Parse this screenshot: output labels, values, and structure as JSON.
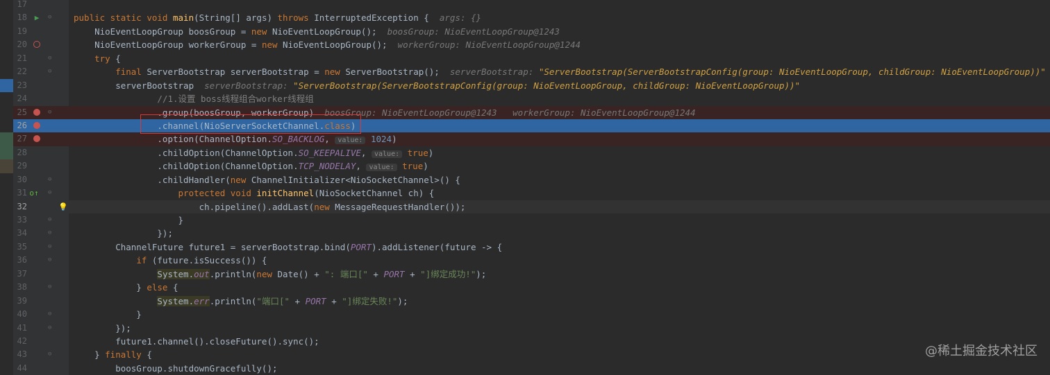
{
  "colors": {
    "editor_bg": "#2b2b2b",
    "gutter_bg": "#313335",
    "selection": "#2f65a0",
    "breakpoint_line": "#3a2323",
    "keyword": "#cc7832",
    "function": "#ffc66d",
    "string": "#6a8759",
    "number": "#6897bb",
    "constant": "#9876aa",
    "comment": "#808080"
  },
  "watermark": "@稀土掘金技术社区",
  "lines": [
    {
      "num": "17",
      "gutter": "none",
      "html": ""
    },
    {
      "num": "18",
      "gutter": "run",
      "html": "<span class='kw'>public static void </span><span class='fn'>main</span>(String[] args) <span class='kw'>throws </span>InterruptedException {  <span class='hint'>args: {}</span>"
    },
    {
      "num": "19",
      "gutter": "none",
      "html": "    NioEventLoopGroup boosGroup = <span class='kw'>new </span>NioEventLoopGroup();  <span class='hint'>boosGroup: NioEventLoopGroup@1243</span>"
    },
    {
      "num": "20",
      "gutter": "bp-hollow",
      "html": "    NioEventLoopGroup workerGroup = <span class='kw'>new </span>NioEventLoopGroup();  <span class='hint'>workerGroup: NioEventLoopGroup@1244</span>"
    },
    {
      "num": "21",
      "gutter": "none",
      "html": "    <span class='kw'>try </span>{"
    },
    {
      "num": "22",
      "gutter": "none",
      "html": "        <span class='kw'>final </span>ServerBootstrap serverBootstrap = <span class='kw'>new </span>ServerBootstrap();  <span class='hint'>serverBootstrap: </span><span class='hstr'>\"ServerBootstrap(ServerBootstrapConfig(group: NioEventLoopGroup, childGroup: NioEventLoopGroup))\"</span>"
    },
    {
      "num": "23",
      "gutter": "none",
      "html": "        serverBootstrap  <span class='hint'>serverBootstrap: </span><span class='hstr'>\"ServerBootstrap(ServerBootstrapConfig(group: NioEventLoopGroup, childGroup: NioEventLoopGroup))\"</span>"
    },
    {
      "num": "24",
      "gutter": "none",
      "html": "                <span class='cmt'>//1.设置 boss线程组合worker线程组</span>"
    },
    {
      "num": "25",
      "gutter": "bp",
      "html": "                .group(boosGroup, workerGroup)  <span class='hint'>boosGroup: NioEventLoopGroup@1243   workerGroup: NioEventLoopGroup@1244</span>"
    },
    {
      "num": "26",
      "gutter": "bp",
      "html": "                .channel(NioServerSocketChannel.<span class='kw'>class</span>)"
    },
    {
      "num": "27",
      "gutter": "bp",
      "html": "                .option(ChannelOption.<span class='const'>SO_BACKLOG</span>, <span class='pill'>value:</span> <span class='num'>1024</span>)"
    },
    {
      "num": "28",
      "gutter": "none",
      "html": "                .childOption(ChannelOption.<span class='const'>SO_KEEPALIVE</span>, <span class='pill'>value:</span> <span class='kw'>true</span>)"
    },
    {
      "num": "29",
      "gutter": "none",
      "html": "                .childOption(ChannelOption.<span class='const'>TCP_NODELAY</span>, <span class='pill'>value:</span> <span class='kw'>true</span>)"
    },
    {
      "num": "30",
      "gutter": "none",
      "html": "                .childHandler(<span class='kw'>new </span>ChannelInitializer&lt;NioSocketChannel&gt;() {"
    },
    {
      "num": "31",
      "gutter": "override",
      "html": "                    <span class='kw'>protected void </span><span class='fn'>initChannel</span>(NioSocketChannel ch) {"
    },
    {
      "num": "32",
      "gutter": "bulb",
      "html": "                        ch.pipeline().addLast(<span class='kw'>new </span>MessageRequestHandler());"
    },
    {
      "num": "33",
      "gutter": "none",
      "html": "                    }"
    },
    {
      "num": "34",
      "gutter": "none",
      "html": "                });"
    },
    {
      "num": "35",
      "gutter": "none",
      "html": "        ChannelFuture future1 = serverBootstrap.bind(<span class='const'>PORT</span>).addListener(future -&gt; {"
    },
    {
      "num": "36",
      "gutter": "none",
      "html": "            <span class='kw'>if </span>(future.isSuccess()) {"
    },
    {
      "num": "37",
      "gutter": "none",
      "html": "                <span class='hl'>System.<span class='const'>out</span></span>.println(<span class='kw'>new </span>Date() + <span class='str'>\": 端口[\"</span> + <span class='const'>PORT</span> + <span class='str'>\"]绑定成功!\"</span>);"
    },
    {
      "num": "38",
      "gutter": "none",
      "html": "            } <span class='kw'>else </span>{"
    },
    {
      "num": "39",
      "gutter": "none",
      "html": "                <span class='hl'>System.<span class='const'>err</span></span>.println(<span class='str'>\"端口[\"</span> + <span class='const'>PORT</span> + <span class='str'>\"]绑定失败!\"</span>);"
    },
    {
      "num": "40",
      "gutter": "none",
      "html": "            }"
    },
    {
      "num": "41",
      "gutter": "none",
      "html": "        });"
    },
    {
      "num": "42",
      "gutter": "none",
      "html": "        future1.channel().closeFuture().sync();"
    },
    {
      "num": "43",
      "gutter": "none",
      "html": "    } <span class='kw'>finally </span>{"
    },
    {
      "num": "44",
      "gutter": "none",
      "html": "        boosGroup.shutdownGracefully();"
    }
  ]
}
